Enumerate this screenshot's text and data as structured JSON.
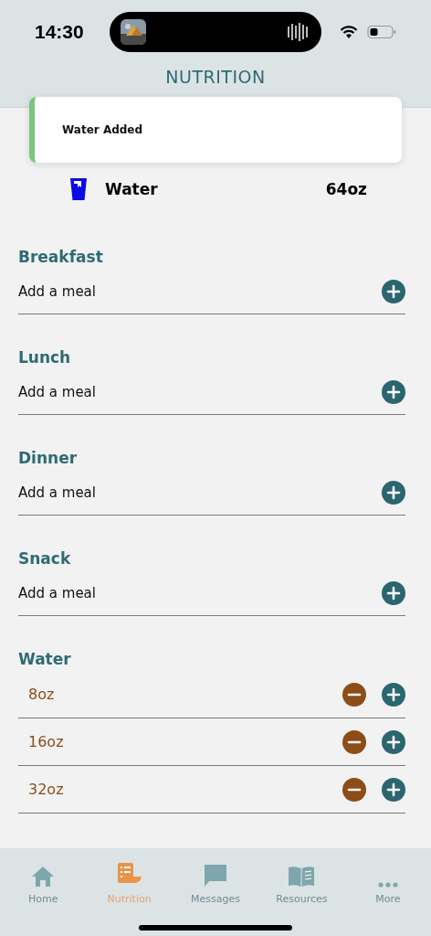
{
  "status_bar": {
    "time": "14:30"
  },
  "header": {
    "title": "NUTRITION"
  },
  "toast": {
    "message": "Water Added"
  },
  "summary": [
    {
      "label": "Water",
      "amount": "64oz"
    }
  ],
  "meals": [
    {
      "name": "Breakfast",
      "action": "Add a meal"
    },
    {
      "name": "Lunch",
      "action": "Add a meal"
    },
    {
      "name": "Dinner",
      "action": "Add a meal"
    },
    {
      "name": "Snack",
      "action": "Add a meal"
    }
  ],
  "water": {
    "title": "Water",
    "options": [
      {
        "amount": "8oz"
      },
      {
        "amount": "16oz"
      },
      {
        "amount": "32oz"
      }
    ]
  },
  "tabs": [
    {
      "label": "Home",
      "kind": "home",
      "selected": false
    },
    {
      "label": "Nutrition",
      "kind": "nutrition",
      "selected": true
    },
    {
      "label": "Messages",
      "kind": "messages",
      "selected": false
    },
    {
      "label": "Resources",
      "kind": "resources",
      "selected": false
    },
    {
      "label": "More",
      "kind": "more",
      "selected": false
    }
  ]
}
